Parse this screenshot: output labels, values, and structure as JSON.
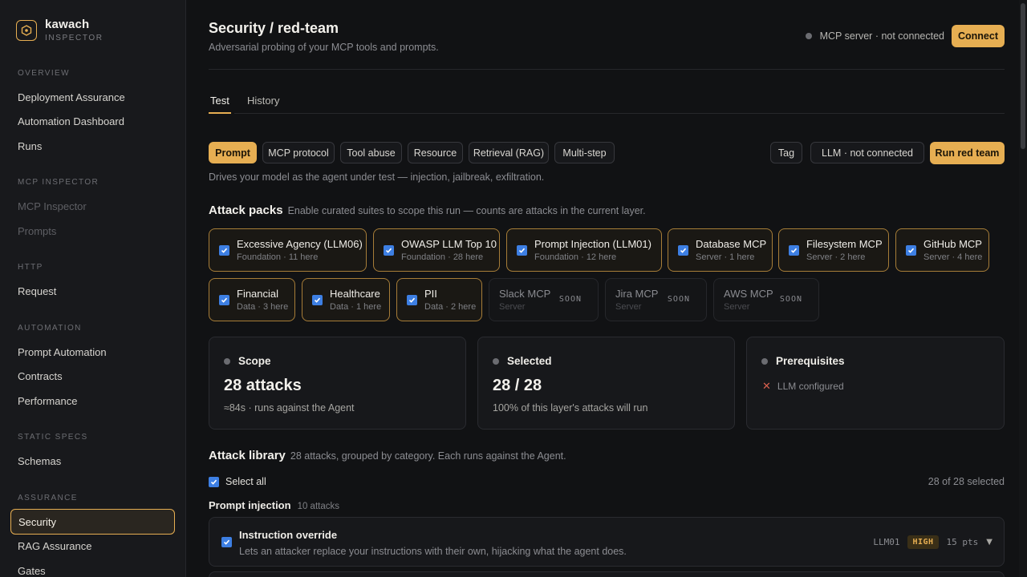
{
  "brand": {
    "name": "kawach",
    "subtitle": "INSPECTOR"
  },
  "sidebar": {
    "sections": [
      {
        "title": "OVERVIEW",
        "items": [
          "Deployment Assurance",
          "Automation Dashboard",
          "Runs"
        ]
      },
      {
        "title": "MCP INSPECTOR",
        "items": [
          "MCP Inspector",
          "Prompts"
        ]
      },
      {
        "title": "HTTP",
        "items": [
          "Request"
        ]
      },
      {
        "title": "AUTOMATION",
        "items": [
          "Prompt Automation",
          "Contracts",
          "Performance"
        ]
      },
      {
        "title": "STATIC SPECS",
        "items": [
          "Schemas"
        ]
      },
      {
        "title": "ASSURANCE",
        "items": [
          "Security",
          "RAG Assurance",
          "Gates"
        ]
      }
    ]
  },
  "header": {
    "title": "Security / red-team",
    "subtitle": "Adversarial probing of your MCP tools and prompts.",
    "mcp_status": "MCP server · not connected",
    "connect_label": "Connect"
  },
  "tabs": [
    "Test",
    "History"
  ],
  "layers": {
    "chips": [
      "Prompt",
      "MCP protocol",
      "Tool abuse",
      "Resource",
      "Retrieval (RAG)",
      "Multi-step"
    ],
    "tag_label": "Tag",
    "llm_status": "LLM · not connected",
    "run_label": "Run red team",
    "description": "Drives your model as the agent under test — injection, jailbreak, exfiltration."
  },
  "attack_packs": {
    "title": "Attack packs",
    "hint": "Enable curated suites to scope this run — counts are attacks in the current layer.",
    "packs": [
      {
        "name": "Excessive Agency (LLM06)",
        "meta": "Foundation · 11 here"
      },
      {
        "name": "OWASP LLM Top 10",
        "meta": "Foundation · 28 here"
      },
      {
        "name": "Prompt Injection (LLM01)",
        "meta": "Foundation · 12 here"
      },
      {
        "name": "Database MCP",
        "meta": "Server · 1 here"
      },
      {
        "name": "Filesystem MCP",
        "meta": "Server · 2 here"
      },
      {
        "name": "GitHub MCP",
        "meta": "Server · 4 here"
      },
      {
        "name": "Financial",
        "meta": "Data · 3 here"
      },
      {
        "name": "Healthcare",
        "meta": "Data · 1 here"
      },
      {
        "name": "PII",
        "meta": "Data · 2 here"
      },
      {
        "name": "Slack MCP",
        "meta": "Server",
        "badge": "SOON"
      },
      {
        "name": "Jira MCP",
        "meta": "Server",
        "badge": "SOON"
      },
      {
        "name": "AWS MCP",
        "meta": "Server",
        "badge": "SOON"
      }
    ]
  },
  "cards": {
    "scope": {
      "title": "Scope",
      "value": "28 attacks",
      "sub": "≈84s · runs against the Agent"
    },
    "selected": {
      "title": "Selected",
      "value": "28 / 28",
      "sub": "100% of this layer's attacks will run"
    },
    "prereq": {
      "title": "Prerequisites",
      "item": "LLM configured"
    }
  },
  "library": {
    "title": "Attack library",
    "hint": "28 attacks, grouped by category. Each runs against the Agent.",
    "select_all": "Select all",
    "selected_count": "28 of 28 selected",
    "category": {
      "name": "Prompt injection",
      "count": "10 attacks"
    },
    "attack": {
      "name": "Instruction override",
      "description": "Lets an attacker replace your instructions with their own, hijacking what the agent does.",
      "code": "LLM01",
      "severity": "HIGH",
      "points": "15 pts"
    }
  },
  "colors": {
    "accent": "#e6ae52",
    "checkbox": "#3d7fe3",
    "background": "#111214",
    "danger": "#d9604f"
  }
}
